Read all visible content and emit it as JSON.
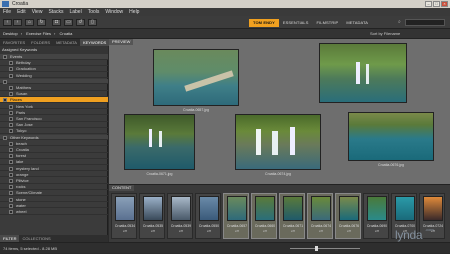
{
  "window": {
    "title": "Croatia"
  },
  "menu": [
    "File",
    "Edit",
    "View",
    "Stacks",
    "Label",
    "Tools",
    "Window",
    "Help"
  ],
  "workspaces": [
    {
      "label": "ESSENTIALS",
      "active": false
    },
    {
      "label": "FILMSTRIP",
      "active": false
    },
    {
      "label": "METADATA",
      "active": false
    }
  ],
  "workspace_active": "TOM ENDY",
  "path": [
    "Desktop",
    "Exercise Files",
    "Croatia"
  ],
  "sort_label": "Sort by Filename",
  "left_tabs": [
    "FAVORITES",
    "FOLDERS",
    "METADATA"
  ],
  "left_tab_active": "KEYWORDS",
  "keywords_header": "Assigned Keywords",
  "keywords": [
    {
      "label": "Events",
      "type": "cat"
    },
    {
      "label": "Birthday",
      "type": "item"
    },
    {
      "label": "Graduation",
      "type": "item"
    },
    {
      "label": "Wedding",
      "type": "item"
    },
    {
      "label": "",
      "type": "cat"
    },
    {
      "label": "Matthew",
      "type": "item"
    },
    {
      "label": "Susan",
      "type": "item"
    },
    {
      "label": "Places",
      "type": "sel"
    },
    {
      "label": "New York",
      "type": "item"
    },
    {
      "label": "Paris",
      "type": "item"
    },
    {
      "label": "San Francisco",
      "type": "item"
    },
    {
      "label": "San Jose",
      "type": "item"
    },
    {
      "label": "Tokyo",
      "type": "item"
    },
    {
      "label": "Other Keywords",
      "type": "cat"
    },
    {
      "label": "beach",
      "type": "item"
    },
    {
      "label": "Croatia",
      "type": "item"
    },
    {
      "label": "forest",
      "type": "item"
    },
    {
      "label": "lake",
      "type": "item"
    },
    {
      "label": "mystery land",
      "type": "item"
    },
    {
      "label": "orange",
      "type": "item"
    },
    {
      "label": "Plitvice",
      "type": "item"
    },
    {
      "label": "rocks",
      "type": "item"
    },
    {
      "label": "Scene/Climate",
      "type": "item"
    },
    {
      "label": "stone",
      "type": "item"
    },
    {
      "label": "water",
      "type": "item"
    },
    {
      "label": "wheel",
      "type": "item"
    }
  ],
  "left_bottom_tabs": [
    "FILTER",
    "COLLECTIONS"
  ],
  "preview_tab": "PREVIEW",
  "preview_captions": [
    "Croatia-0657.jpg",
    "",
    "Croatia-0671.jpg",
    "Croatia-0674.jpg",
    "Croatia-0676.jpg"
  ],
  "filmstrip_tab": "CONTENT",
  "filmstrip": [
    {
      "name": "Croatia-0534",
      "stars": "2/8"
    },
    {
      "name": "Croatia-0535",
      "stars": "2/8"
    },
    {
      "name": "Croatia-0539",
      "stars": "2/8"
    },
    {
      "name": "Croatia-0550",
      "stars": "2/8"
    },
    {
      "name": "Croatia-0657",
      "stars": "2/8"
    },
    {
      "name": "Croatia-0660",
      "stars": "2/8"
    },
    {
      "name": "Croatia-0671",
      "stars": "2/8"
    },
    {
      "name": "Croatia-0674",
      "stars": "2/8"
    },
    {
      "name": "Croatia-0676",
      "stars": "2/8"
    },
    {
      "name": "Croatia-0690",
      "stars": "2/8"
    },
    {
      "name": "Croatia-0700",
      "stars": "2/8"
    },
    {
      "name": "Croatia-0724",
      "stars": "2/8"
    }
  ],
  "selected_indices": [
    4,
    5,
    6,
    7,
    8
  ],
  "status": "74 items, 5 selected - 8.28 MB",
  "watermark": "lynda",
  "watermark_suffix": ".com",
  "colors": {
    "accent": "#f0a020"
  },
  "icons": [
    "back-icon",
    "forward-icon",
    "home-icon",
    "refresh-icon",
    "camera-icon",
    "folder-icon",
    "search-icon",
    "trash-icon",
    "rotate-icon"
  ]
}
